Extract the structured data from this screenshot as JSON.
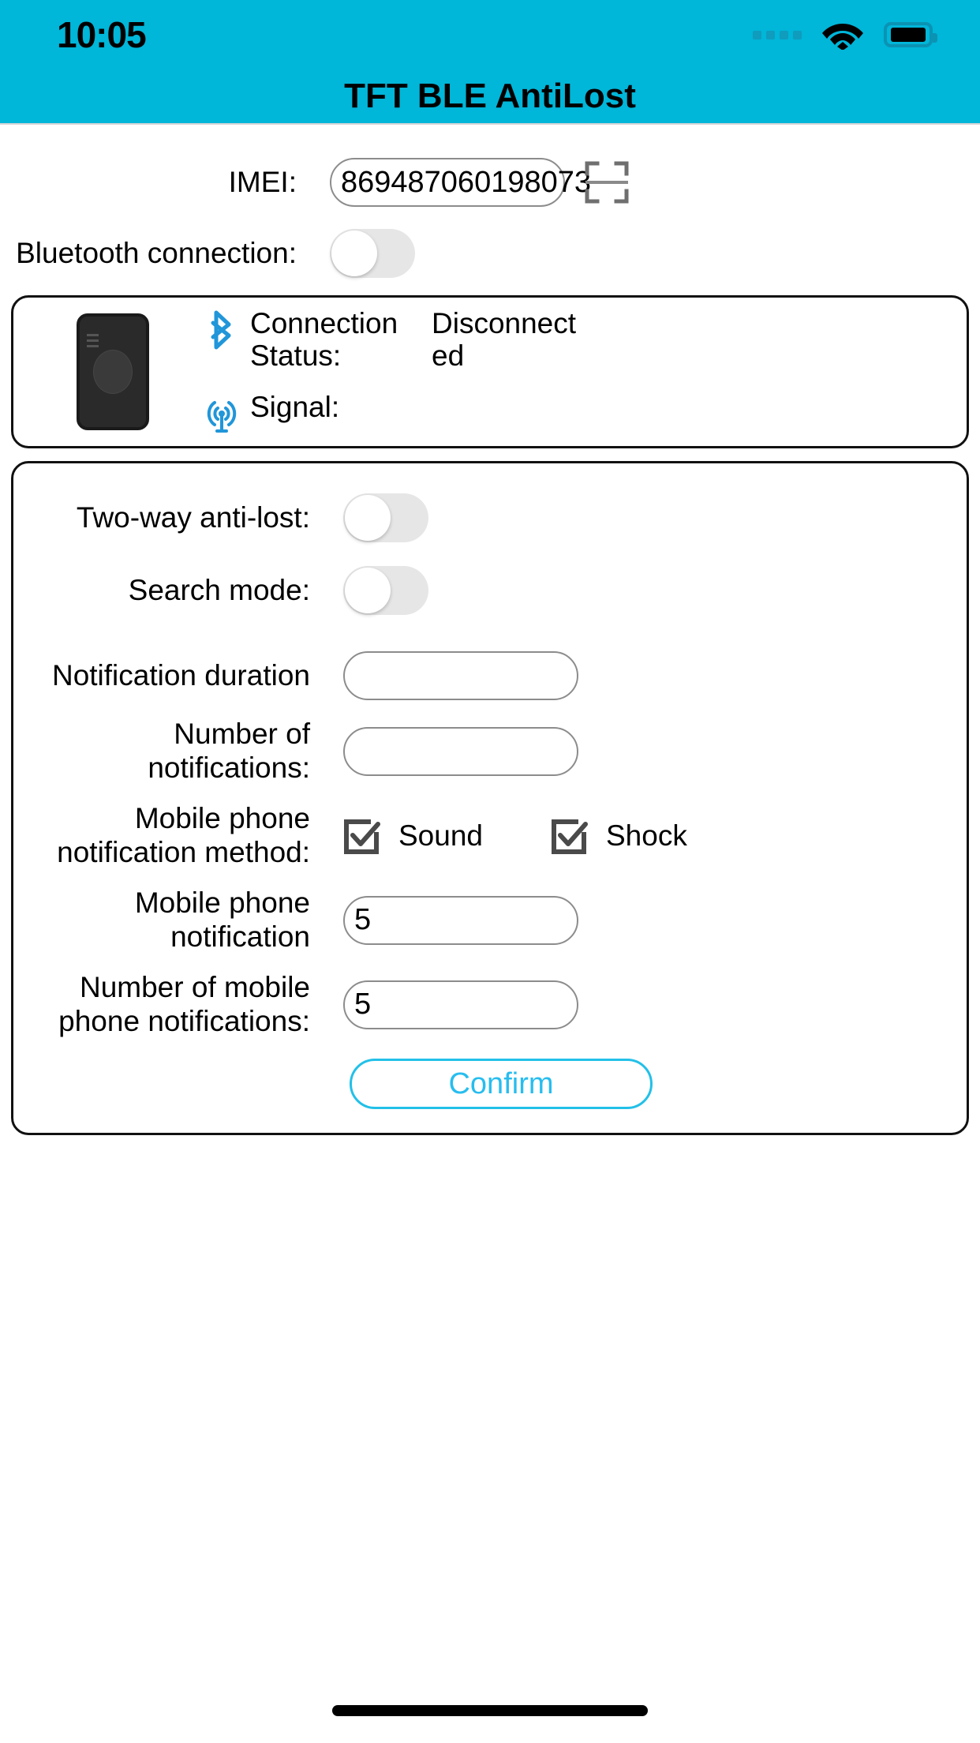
{
  "status_bar": {
    "time": "10:05",
    "signal_icon": "signal-dots-icon",
    "wifi_icon": "wifi-icon",
    "battery_icon": "battery-full-icon"
  },
  "header": {
    "title": "TFT BLE AntiLost",
    "background_color": "#00b6d9"
  },
  "imei_row": {
    "label": "IMEI:",
    "value": "869487060198073",
    "placeholder": "",
    "scan_icon": "scan-barcode-icon"
  },
  "bluetooth_row": {
    "label": "Bluetooth connection:",
    "toggle_state": "off"
  },
  "device_card": {
    "device_image": "ble-tracker-device-image",
    "lines": [
      {
        "icon": "bluetooth-icon",
        "key": "Connection Status:",
        "value": "Disconnected"
      },
      {
        "icon": "signal-tower-icon",
        "key": "Signal:",
        "value": ""
      }
    ]
  },
  "settings_card": {
    "two_way": {
      "label": "Two-way anti-lost:",
      "toggle_state": "off"
    },
    "search_mode": {
      "label": "Search mode:",
      "toggle_state": "off"
    },
    "notification_duration": {
      "label": "Notification duration",
      "value": "",
      "placeholder": ""
    },
    "number_of_notifications": {
      "label": "Number of notifications:",
      "value": "",
      "placeholder": ""
    },
    "notification_method": {
      "label": "Mobile phone notification method:",
      "options": [
        {
          "label": "Sound",
          "checked": true,
          "icon": "checkbox-checked-icon"
        },
        {
          "label": "Shock",
          "checked": true,
          "icon": "checkbox-checked-icon"
        }
      ]
    },
    "phone_notification": {
      "label": "Mobile phone notification",
      "value": "5",
      "placeholder": ""
    },
    "phone_notification_count": {
      "label": "Number of mobile phone notifications:",
      "value": "5",
      "placeholder": ""
    },
    "confirm_button": {
      "label": "Confirm",
      "color": "#27bdef"
    }
  },
  "home_indicator": "home-indicator"
}
